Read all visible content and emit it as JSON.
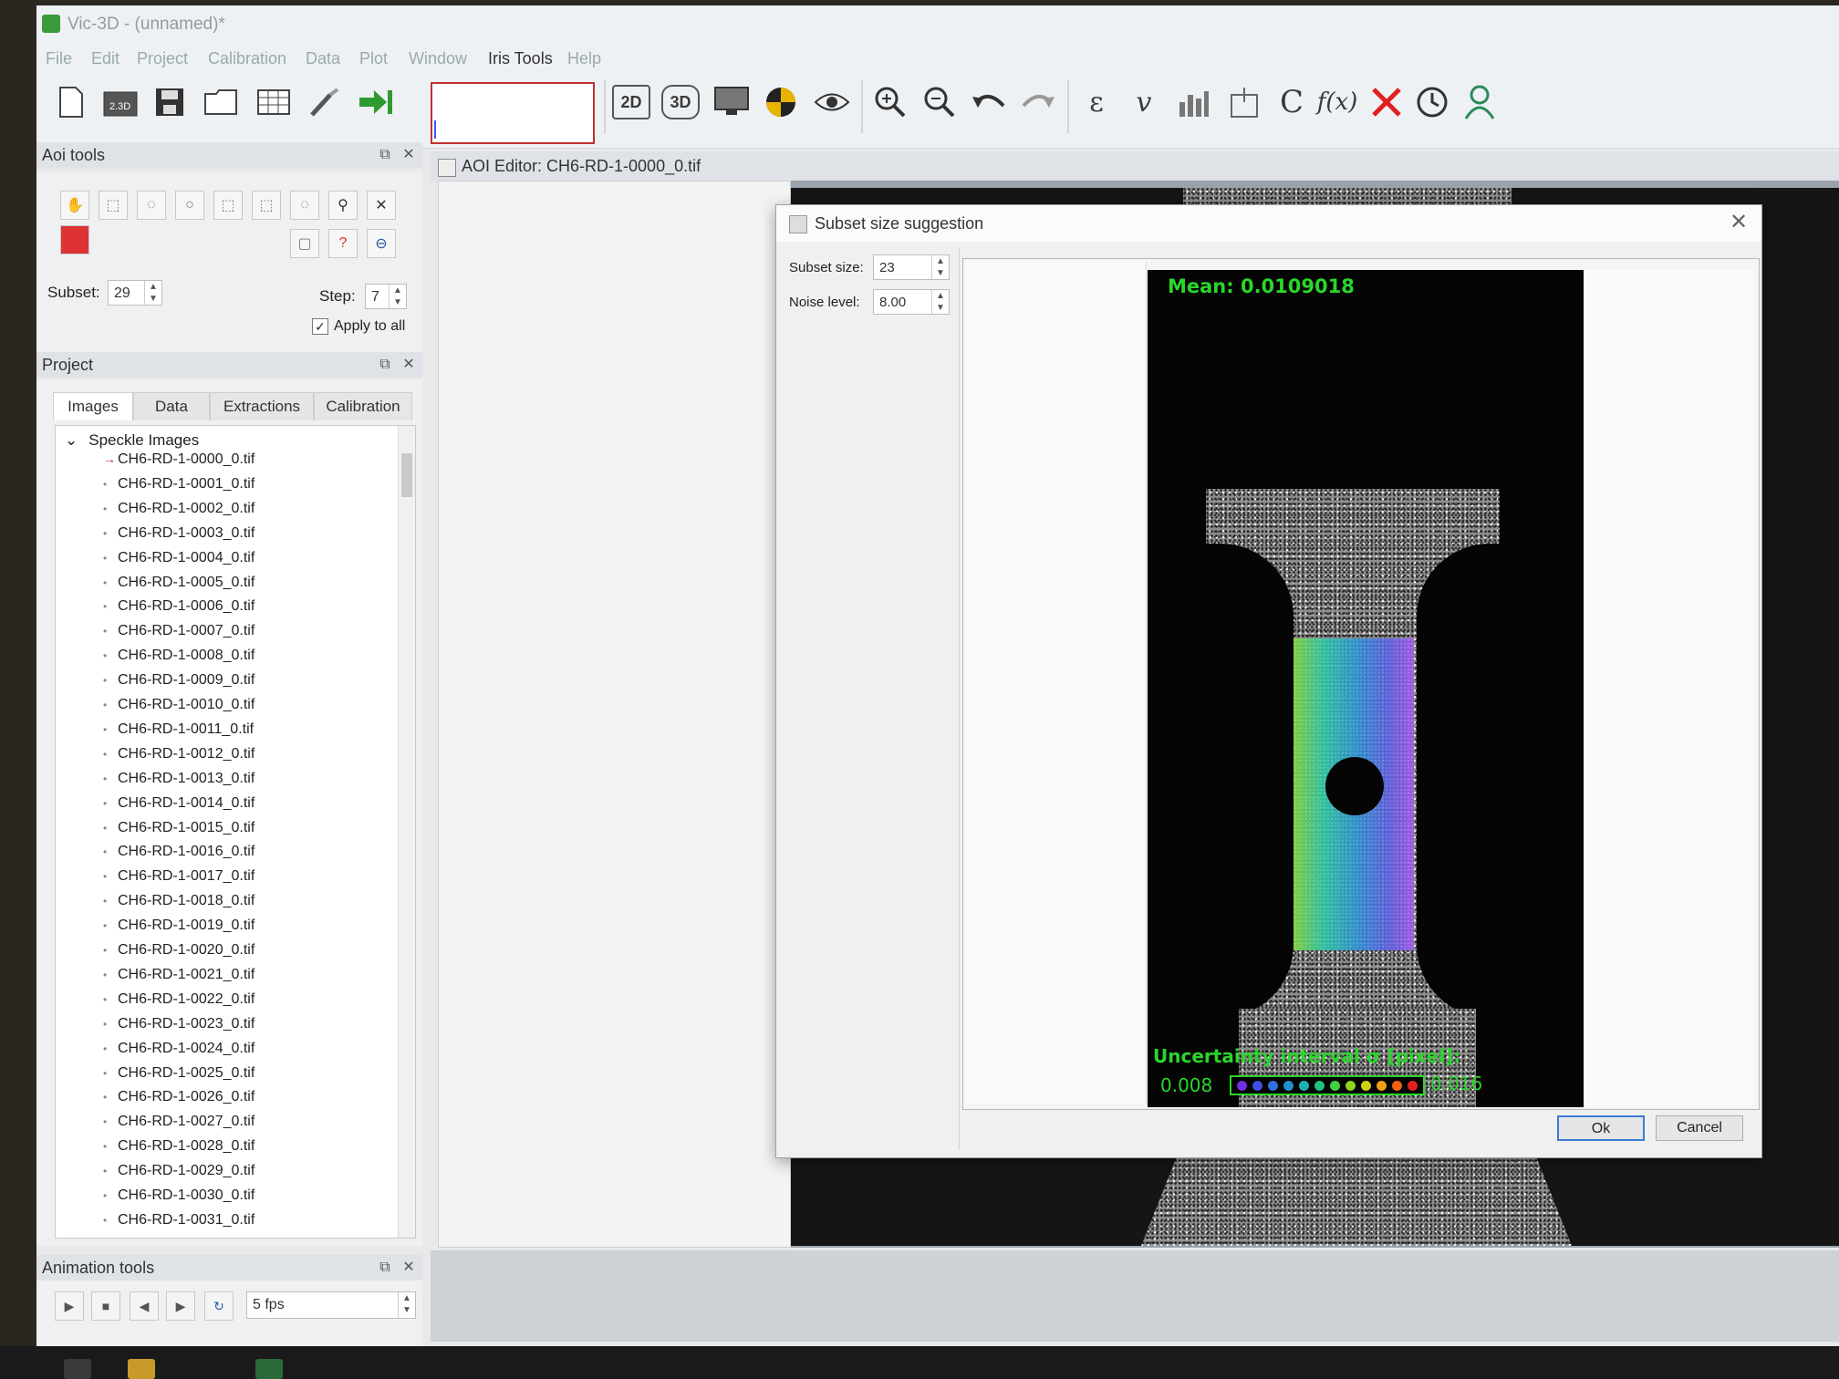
{
  "window": {
    "title": "Vic-3D - (unnamed)*"
  },
  "menu": [
    "File",
    "Edit",
    "Project",
    "Calibration",
    "Data",
    "Plot",
    "Window",
    "Iris Tools",
    "Help"
  ],
  "toolbar": {
    "btn_2d": "2D",
    "btn_3d": "3D",
    "open_vic_label": "2.3D",
    "strain_symbol": "ε",
    "velocity_symbol": "v",
    "c_symbol": "C",
    "fx_symbol": "f(x)"
  },
  "aoi_tools": {
    "title": "Aoi tools",
    "subset_label": "Subset:",
    "subset_value": "29",
    "step_label": "Step:",
    "step_value": "7",
    "apply_label": "Apply to all",
    "apply_checked": "✓"
  },
  "project": {
    "title": "Project",
    "tabs": [
      "Images",
      "Data",
      "Extractions",
      "Calibration"
    ],
    "tree_root": "Speckle Images",
    "images": [
      "CH6-RD-1-0000_0.tif",
      "CH6-RD-1-0001_0.tif",
      "CH6-RD-1-0002_0.tif",
      "CH6-RD-1-0003_0.tif",
      "CH6-RD-1-0004_0.tif",
      "CH6-RD-1-0005_0.tif",
      "CH6-RD-1-0006_0.tif",
      "CH6-RD-1-0007_0.tif",
      "CH6-RD-1-0008_0.tif",
      "CH6-RD-1-0009_0.tif",
      "CH6-RD-1-0010_0.tif",
      "CH6-RD-1-0011_0.tif",
      "CH6-RD-1-0012_0.tif",
      "CH6-RD-1-0013_0.tif",
      "CH6-RD-1-0014_0.tif",
      "CH6-RD-1-0015_0.tif",
      "CH6-RD-1-0016_0.tif",
      "CH6-RD-1-0017_0.tif",
      "CH6-RD-1-0018_0.tif",
      "CH6-RD-1-0019_0.tif",
      "CH6-RD-1-0020_0.tif",
      "CH6-RD-1-0021_0.tif",
      "CH6-RD-1-0022_0.tif",
      "CH6-RD-1-0023_0.tif",
      "CH6-RD-1-0024_0.tif",
      "CH6-RD-1-0025_0.tif",
      "CH6-RD-1-0026_0.tif",
      "CH6-RD-1-0027_0.tif",
      "CH6-RD-1-0028_0.tif",
      "CH6-RD-1-0029_0.tif",
      "CH6-RD-1-0030_0.tif",
      "CH6-RD-1-0031_0.tif"
    ]
  },
  "animation": {
    "title": "Animation tools",
    "fps_value": "5 fps"
  },
  "editor": {
    "title": "AOI Editor: CH6-RD-1-0000_0.tif"
  },
  "dialog": {
    "title": "Subset size suggestion",
    "subset_label": "Subset size:",
    "subset_value": "23",
    "noise_label": "Noise level:",
    "noise_value": "8.00",
    "mean_text": "Mean: 0.0109018",
    "uncertainty_label": "Uncertainty interval σ [pixel]:",
    "scale_min": "0.008",
    "scale_max": "0.016",
    "ok_label": "Ok",
    "cancel_label": "Cancel",
    "close_glyph": "✕"
  },
  "colors": {
    "overlay_text": "#2ad62a",
    "accent_button": "#3a7bd5",
    "scale_stops": [
      "#7030e0",
      "#4050e0",
      "#3070e0",
      "#2090d0",
      "#20b0b0",
      "#20c080",
      "#40d040",
      "#90d020",
      "#d0d010",
      "#f0a010",
      "#f06010",
      "#e02020"
    ]
  },
  "icons": {
    "new": "new-file-icon",
    "open_project": "open-project-icon",
    "save": "save-icon",
    "folder": "open-folder-icon",
    "calendar": "grid-icon",
    "wand": "wand-icon",
    "run": "run-analysis-icon",
    "zoom_in": "zoom-in-icon",
    "zoom_out": "zoom-out-icon",
    "undo": "undo-icon",
    "redo": "redo-icon"
  }
}
